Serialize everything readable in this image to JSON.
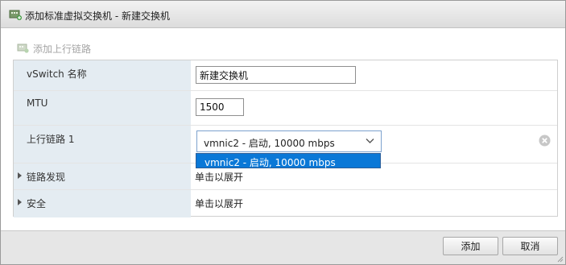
{
  "dialog": {
    "title": "添加标准虚拟交换机 - 新建交换机",
    "title_icon": "virtual-switch-add-icon"
  },
  "toolbar": {
    "add_uplink_label": "添加上行链路",
    "add_uplink_icon": "add-uplink-icon"
  },
  "form": {
    "vswitch_name": {
      "label": "vSwitch 名称",
      "value": "新建交换机"
    },
    "mtu": {
      "label": "MTU",
      "value": "1500"
    },
    "uplink": {
      "label": "上行链路 1",
      "selected": "vmnic2 - 启动, 10000 mbps",
      "options": [
        "vmnic2 - 启动, 10000 mbps"
      ],
      "remove_icon": "remove-circle-icon"
    },
    "link_discovery": {
      "label": "链路发现",
      "value": "单击以展开"
    },
    "security": {
      "label": "安全",
      "value": "单击以展开"
    }
  },
  "footer": {
    "add_label": "添加",
    "cancel_label": "取消"
  },
  "colors": {
    "label_bg": "#e4ecf2",
    "dropdown_highlight": "#0a78d7",
    "select_border": "#7da2ce"
  }
}
